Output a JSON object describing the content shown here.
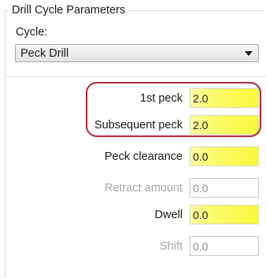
{
  "group": {
    "title": "Drill Cycle Parameters"
  },
  "cycle": {
    "label": "Cycle:",
    "selected": "Peck Drill"
  },
  "fields": {
    "first_peck": {
      "label": "1st peck",
      "value": "2.0"
    },
    "subsequent_peck": {
      "label": "Subsequent peck",
      "value": "2.0"
    },
    "peck_clearance": {
      "label": "Peck clearance",
      "value": "0.0"
    },
    "retract_amount": {
      "label": "Retract amount",
      "value": "0.0"
    },
    "dwell": {
      "label": "Dwell",
      "value": "0.0"
    },
    "shift": {
      "label": "Shift",
      "value": "0.0"
    }
  },
  "colors": {
    "highlight": "#fafa3a",
    "callout": "#b4263b",
    "disabled_text": "#a6a6a6"
  },
  "icons": {
    "dropdown": "chevron-down-icon"
  }
}
